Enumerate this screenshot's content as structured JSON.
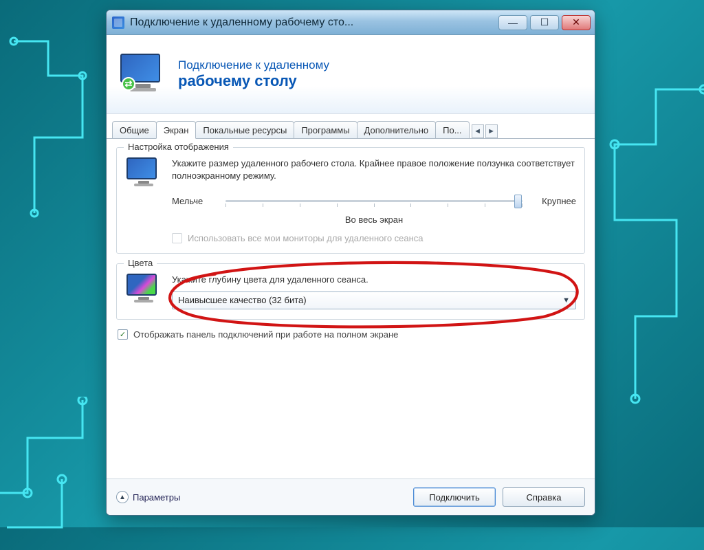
{
  "window": {
    "title": "Подключение к удаленному рабочему сто..."
  },
  "header": {
    "line1": "Подключение к удаленному",
    "line2": "рабочему столу"
  },
  "tabs": {
    "items": [
      {
        "label": "Общие"
      },
      {
        "label": "Экран"
      },
      {
        "label": "Покальные ресурсы"
      },
      {
        "label": "Программы"
      },
      {
        "label": "Дополнительно"
      },
      {
        "label": "По..."
      }
    ]
  },
  "display_group": {
    "legend": "Настройка отображения",
    "description": "Укажите размер удаленного рабочего стола. Крайнее правое положение ползунка соответствует полноэкранному режиму.",
    "slider_min_label": "Мельче",
    "slider_max_label": "Крупнее",
    "slider_value_text": "Во весь экран",
    "all_monitors_checkbox": "Использовать все мои мониторы для удаленного сеанса"
  },
  "colors_group": {
    "legend": "Цвета",
    "description": "Укажите глубину цвета для удаленного сеанса.",
    "combo_value": "Наивысшее качество (32 бита)"
  },
  "connection_bar_checkbox": "Отображать панель подключений при работе на полном экране",
  "footer": {
    "options": "Параметры",
    "connect": "Подключить",
    "help": "Справка"
  }
}
